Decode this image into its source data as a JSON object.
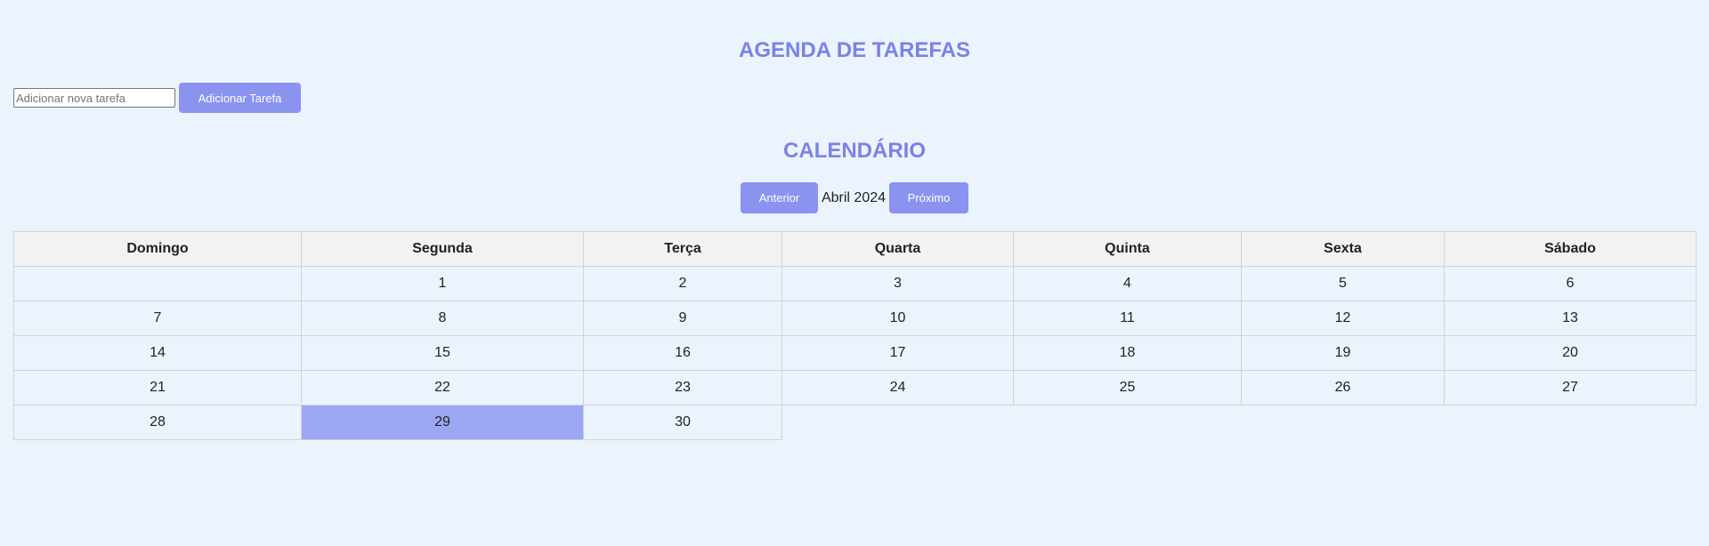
{
  "header": {
    "title": "AGENDA DE TAREFAS"
  },
  "task_form": {
    "placeholder": "Adicionar nova tarefa",
    "value": "",
    "add_label": "Adicionar Tarefa"
  },
  "calendar": {
    "title": "CALENDÁRIO",
    "prev_label": "Anterior",
    "next_label": "Próximo",
    "month_label": "Abril 2024",
    "weekdays": [
      "Domingo",
      "Segunda",
      "Terça",
      "Quarta",
      "Quinta",
      "Sexta",
      "Sábado"
    ],
    "weeks": [
      [
        "",
        "1",
        "2",
        "3",
        "4",
        "5",
        "6"
      ],
      [
        "7",
        "8",
        "9",
        "10",
        "11",
        "12",
        "13"
      ],
      [
        "14",
        "15",
        "16",
        "17",
        "18",
        "19",
        "20"
      ],
      [
        "21",
        "22",
        "23",
        "24",
        "25",
        "26",
        "27"
      ],
      [
        "28",
        "29",
        "30"
      ]
    ],
    "highlighted_day": "29",
    "colors": {
      "accent": "#7b82e4",
      "button": "#8a93f0",
      "highlight": "#9da8f5",
      "background": "#ebf3fd",
      "header_bg": "#f2f2f2"
    }
  }
}
